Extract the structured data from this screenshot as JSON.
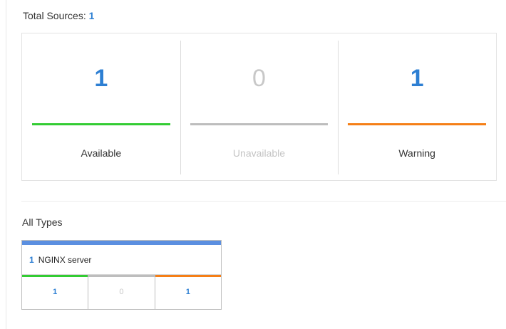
{
  "summary": {
    "total_label": "Total Sources:",
    "total_count": "1",
    "stats": [
      {
        "value": "1",
        "label": "Available",
        "color": "#33cc33"
      },
      {
        "value": "0",
        "label": "Unavailable",
        "color": "#bdbdbd"
      },
      {
        "value": "1",
        "label": "Warning",
        "color": "#f57f17"
      }
    ]
  },
  "types": {
    "heading": "All Types",
    "items": [
      {
        "count": "1",
        "name": "NGINX server",
        "accent": "#5b8fe0",
        "stats": [
          {
            "value": "1",
            "color": "#33cc33"
          },
          {
            "value": "0",
            "color": "#bdbdbd"
          },
          {
            "value": "1",
            "color": "#f57f17"
          }
        ]
      }
    ]
  }
}
